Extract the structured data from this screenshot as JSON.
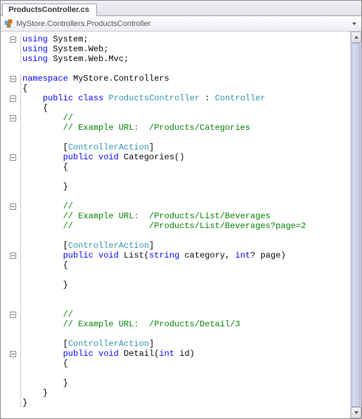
{
  "tab": {
    "filename": "ProductsController.cs"
  },
  "breadcrumb": {
    "path": "MyStore.Controllers.ProductsController"
  },
  "code": {
    "lines": [
      {
        "outline": "minus",
        "segments": [
          {
            "cls": "kw",
            "t": "using"
          },
          {
            "cls": "txt",
            "t": " System;"
          }
        ]
      },
      {
        "outline": "bar",
        "segments": [
          {
            "cls": "kw",
            "t": "using"
          },
          {
            "cls": "txt",
            "t": " System.Web;"
          }
        ]
      },
      {
        "outline": "bar",
        "segments": [
          {
            "cls": "kw",
            "t": "using"
          },
          {
            "cls": "txt",
            "t": " System.Web.Mvc;"
          }
        ]
      },
      {
        "outline": "",
        "segments": []
      },
      {
        "outline": "minus",
        "segments": [
          {
            "cls": "kw",
            "t": "namespace"
          },
          {
            "cls": "txt",
            "t": " MyStore.Controllers"
          }
        ]
      },
      {
        "outline": "bar",
        "segments": [
          {
            "cls": "txt",
            "t": "{"
          }
        ]
      },
      {
        "outline": "minus",
        "indent": 4,
        "segments": [
          {
            "cls": "kw",
            "t": "public"
          },
          {
            "cls": "txt",
            "t": " "
          },
          {
            "cls": "kw",
            "t": "class"
          },
          {
            "cls": "txt",
            "t": " "
          },
          {
            "cls": "type",
            "t": "ProductsController"
          },
          {
            "cls": "txt",
            "t": " : "
          },
          {
            "cls": "type",
            "t": "Controller"
          }
        ]
      },
      {
        "outline": "bar",
        "indent": 4,
        "segments": [
          {
            "cls": "txt",
            "t": "{"
          }
        ]
      },
      {
        "outline": "minus",
        "indent": 8,
        "segments": [
          {
            "cls": "com",
            "t": "//"
          }
        ]
      },
      {
        "outline": "bar",
        "indent": 8,
        "segments": [
          {
            "cls": "com",
            "t": "// Example URL:  /Products/Categories"
          }
        ]
      },
      {
        "outline": "bar",
        "indent": 8,
        "segments": []
      },
      {
        "outline": "bar",
        "indent": 8,
        "segments": [
          {
            "cls": "txt",
            "t": "["
          },
          {
            "cls": "type",
            "t": "ControllerAction"
          },
          {
            "cls": "txt",
            "t": "]"
          }
        ]
      },
      {
        "outline": "minus",
        "indent": 8,
        "segments": [
          {
            "cls": "kw",
            "t": "public"
          },
          {
            "cls": "txt",
            "t": " "
          },
          {
            "cls": "kw",
            "t": "void"
          },
          {
            "cls": "txt",
            "t": " Categories()"
          }
        ]
      },
      {
        "outline": "bar",
        "indent": 8,
        "segments": [
          {
            "cls": "txt",
            "t": "{"
          }
        ]
      },
      {
        "outline": "bar",
        "indent": 8,
        "segments": []
      },
      {
        "outline": "bar",
        "indent": 8,
        "segments": [
          {
            "cls": "txt",
            "t": "}"
          }
        ]
      },
      {
        "outline": "bar",
        "indent": 8,
        "segments": []
      },
      {
        "outline": "minus",
        "indent": 8,
        "segments": [
          {
            "cls": "com",
            "t": "//"
          }
        ]
      },
      {
        "outline": "bar",
        "indent": 8,
        "segments": [
          {
            "cls": "com",
            "t": "// Example URL:  /Products/List/Beverages"
          }
        ]
      },
      {
        "outline": "bar",
        "indent": 8,
        "segments": [
          {
            "cls": "com",
            "t": "//               /Products/List/Beverages?page=2"
          }
        ]
      },
      {
        "outline": "bar",
        "indent": 8,
        "segments": []
      },
      {
        "outline": "bar",
        "indent": 8,
        "segments": [
          {
            "cls": "txt",
            "t": "["
          },
          {
            "cls": "type",
            "t": "ControllerAction"
          },
          {
            "cls": "txt",
            "t": "]"
          }
        ]
      },
      {
        "outline": "minus",
        "indent": 8,
        "segments": [
          {
            "cls": "kw",
            "t": "public"
          },
          {
            "cls": "txt",
            "t": " "
          },
          {
            "cls": "kw",
            "t": "void"
          },
          {
            "cls": "txt",
            "t": " List("
          },
          {
            "cls": "kw",
            "t": "string"
          },
          {
            "cls": "txt",
            "t": " category, "
          },
          {
            "cls": "kw",
            "t": "int"
          },
          {
            "cls": "txt",
            "t": "? page)"
          }
        ]
      },
      {
        "outline": "bar",
        "indent": 8,
        "segments": [
          {
            "cls": "txt",
            "t": "{"
          }
        ]
      },
      {
        "outline": "bar",
        "indent": 8,
        "segments": []
      },
      {
        "outline": "bar",
        "indent": 8,
        "segments": [
          {
            "cls": "txt",
            "t": "}"
          }
        ]
      },
      {
        "outline": "bar",
        "indent": 8,
        "segments": []
      },
      {
        "outline": "bar",
        "indent": 8,
        "segments": []
      },
      {
        "outline": "minus",
        "indent": 8,
        "segments": [
          {
            "cls": "com",
            "t": "//"
          }
        ]
      },
      {
        "outline": "bar",
        "indent": 8,
        "segments": [
          {
            "cls": "com",
            "t": "// Example URL:  /Products/Detail/3"
          }
        ]
      },
      {
        "outline": "bar",
        "indent": 8,
        "segments": []
      },
      {
        "outline": "bar",
        "indent": 8,
        "segments": [
          {
            "cls": "txt",
            "t": "["
          },
          {
            "cls": "type",
            "t": "ControllerAction"
          },
          {
            "cls": "txt",
            "t": "]"
          }
        ]
      },
      {
        "outline": "minus",
        "indent": 8,
        "segments": [
          {
            "cls": "kw",
            "t": "public"
          },
          {
            "cls": "txt",
            "t": " "
          },
          {
            "cls": "kw",
            "t": "void"
          },
          {
            "cls": "txt",
            "t": " Detail("
          },
          {
            "cls": "kw",
            "t": "int"
          },
          {
            "cls": "txt",
            "t": " id)"
          }
        ]
      },
      {
        "outline": "bar",
        "indent": 8,
        "segments": [
          {
            "cls": "txt",
            "t": "{"
          }
        ]
      },
      {
        "outline": "bar",
        "indent": 8,
        "segments": []
      },
      {
        "outline": "bar",
        "indent": 8,
        "segments": [
          {
            "cls": "txt",
            "t": "}"
          }
        ]
      },
      {
        "outline": "bar",
        "indent": 4,
        "segments": [
          {
            "cls": "txt",
            "t": "}"
          }
        ]
      },
      {
        "outline": "bar",
        "segments": [
          {
            "cls": "txt",
            "t": "}"
          }
        ]
      }
    ]
  }
}
